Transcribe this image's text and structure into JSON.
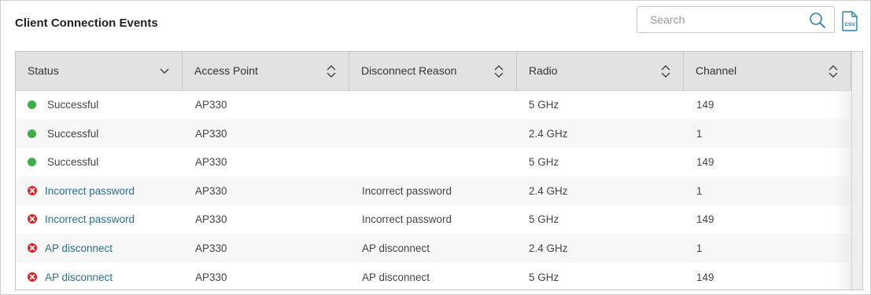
{
  "title": "Client Connection Events",
  "search": {
    "placeholder": "Search"
  },
  "export": {
    "label": "CSV"
  },
  "columns": [
    {
      "label": "Status",
      "sort": "chevron-down"
    },
    {
      "label": "Access Point",
      "sort": "up-down"
    },
    {
      "label": "Disconnect Reason",
      "sort": "up-down"
    },
    {
      "label": "Radio",
      "sort": "up-down"
    },
    {
      "label": "Channel",
      "sort": "up-down"
    }
  ],
  "colors": {
    "success": "#3fae49",
    "error": "#d9262c",
    "link": "#2a6f8f",
    "header_bg": "#e2e2e2"
  },
  "rows": [
    {
      "status": "Successful",
      "type": "success",
      "ap": "AP330",
      "reason": "",
      "radio": "5 GHz",
      "channel": "149"
    },
    {
      "status": "Successful",
      "type": "success",
      "ap": "AP330",
      "reason": "",
      "radio": "2.4 GHz",
      "channel": "1"
    },
    {
      "status": "Successful",
      "type": "success",
      "ap": "AP330",
      "reason": "",
      "radio": "5 GHz",
      "channel": "149"
    },
    {
      "status": "Incorrect password",
      "type": "error",
      "ap": "AP330",
      "reason": "Incorrect password",
      "radio": "2.4 GHz",
      "channel": "1"
    },
    {
      "status": "Incorrect password",
      "type": "error",
      "ap": "AP330",
      "reason": "Incorrect password",
      "radio": "5 GHz",
      "channel": "149"
    },
    {
      "status": "AP disconnect",
      "type": "error",
      "ap": "AP330",
      "reason": "AP disconnect",
      "radio": "2.4 GHz",
      "channel": "1"
    },
    {
      "status": "AP disconnect",
      "type": "error",
      "ap": "AP330",
      "reason": "AP disconnect",
      "radio": "5 GHz",
      "channel": "149"
    }
  ]
}
